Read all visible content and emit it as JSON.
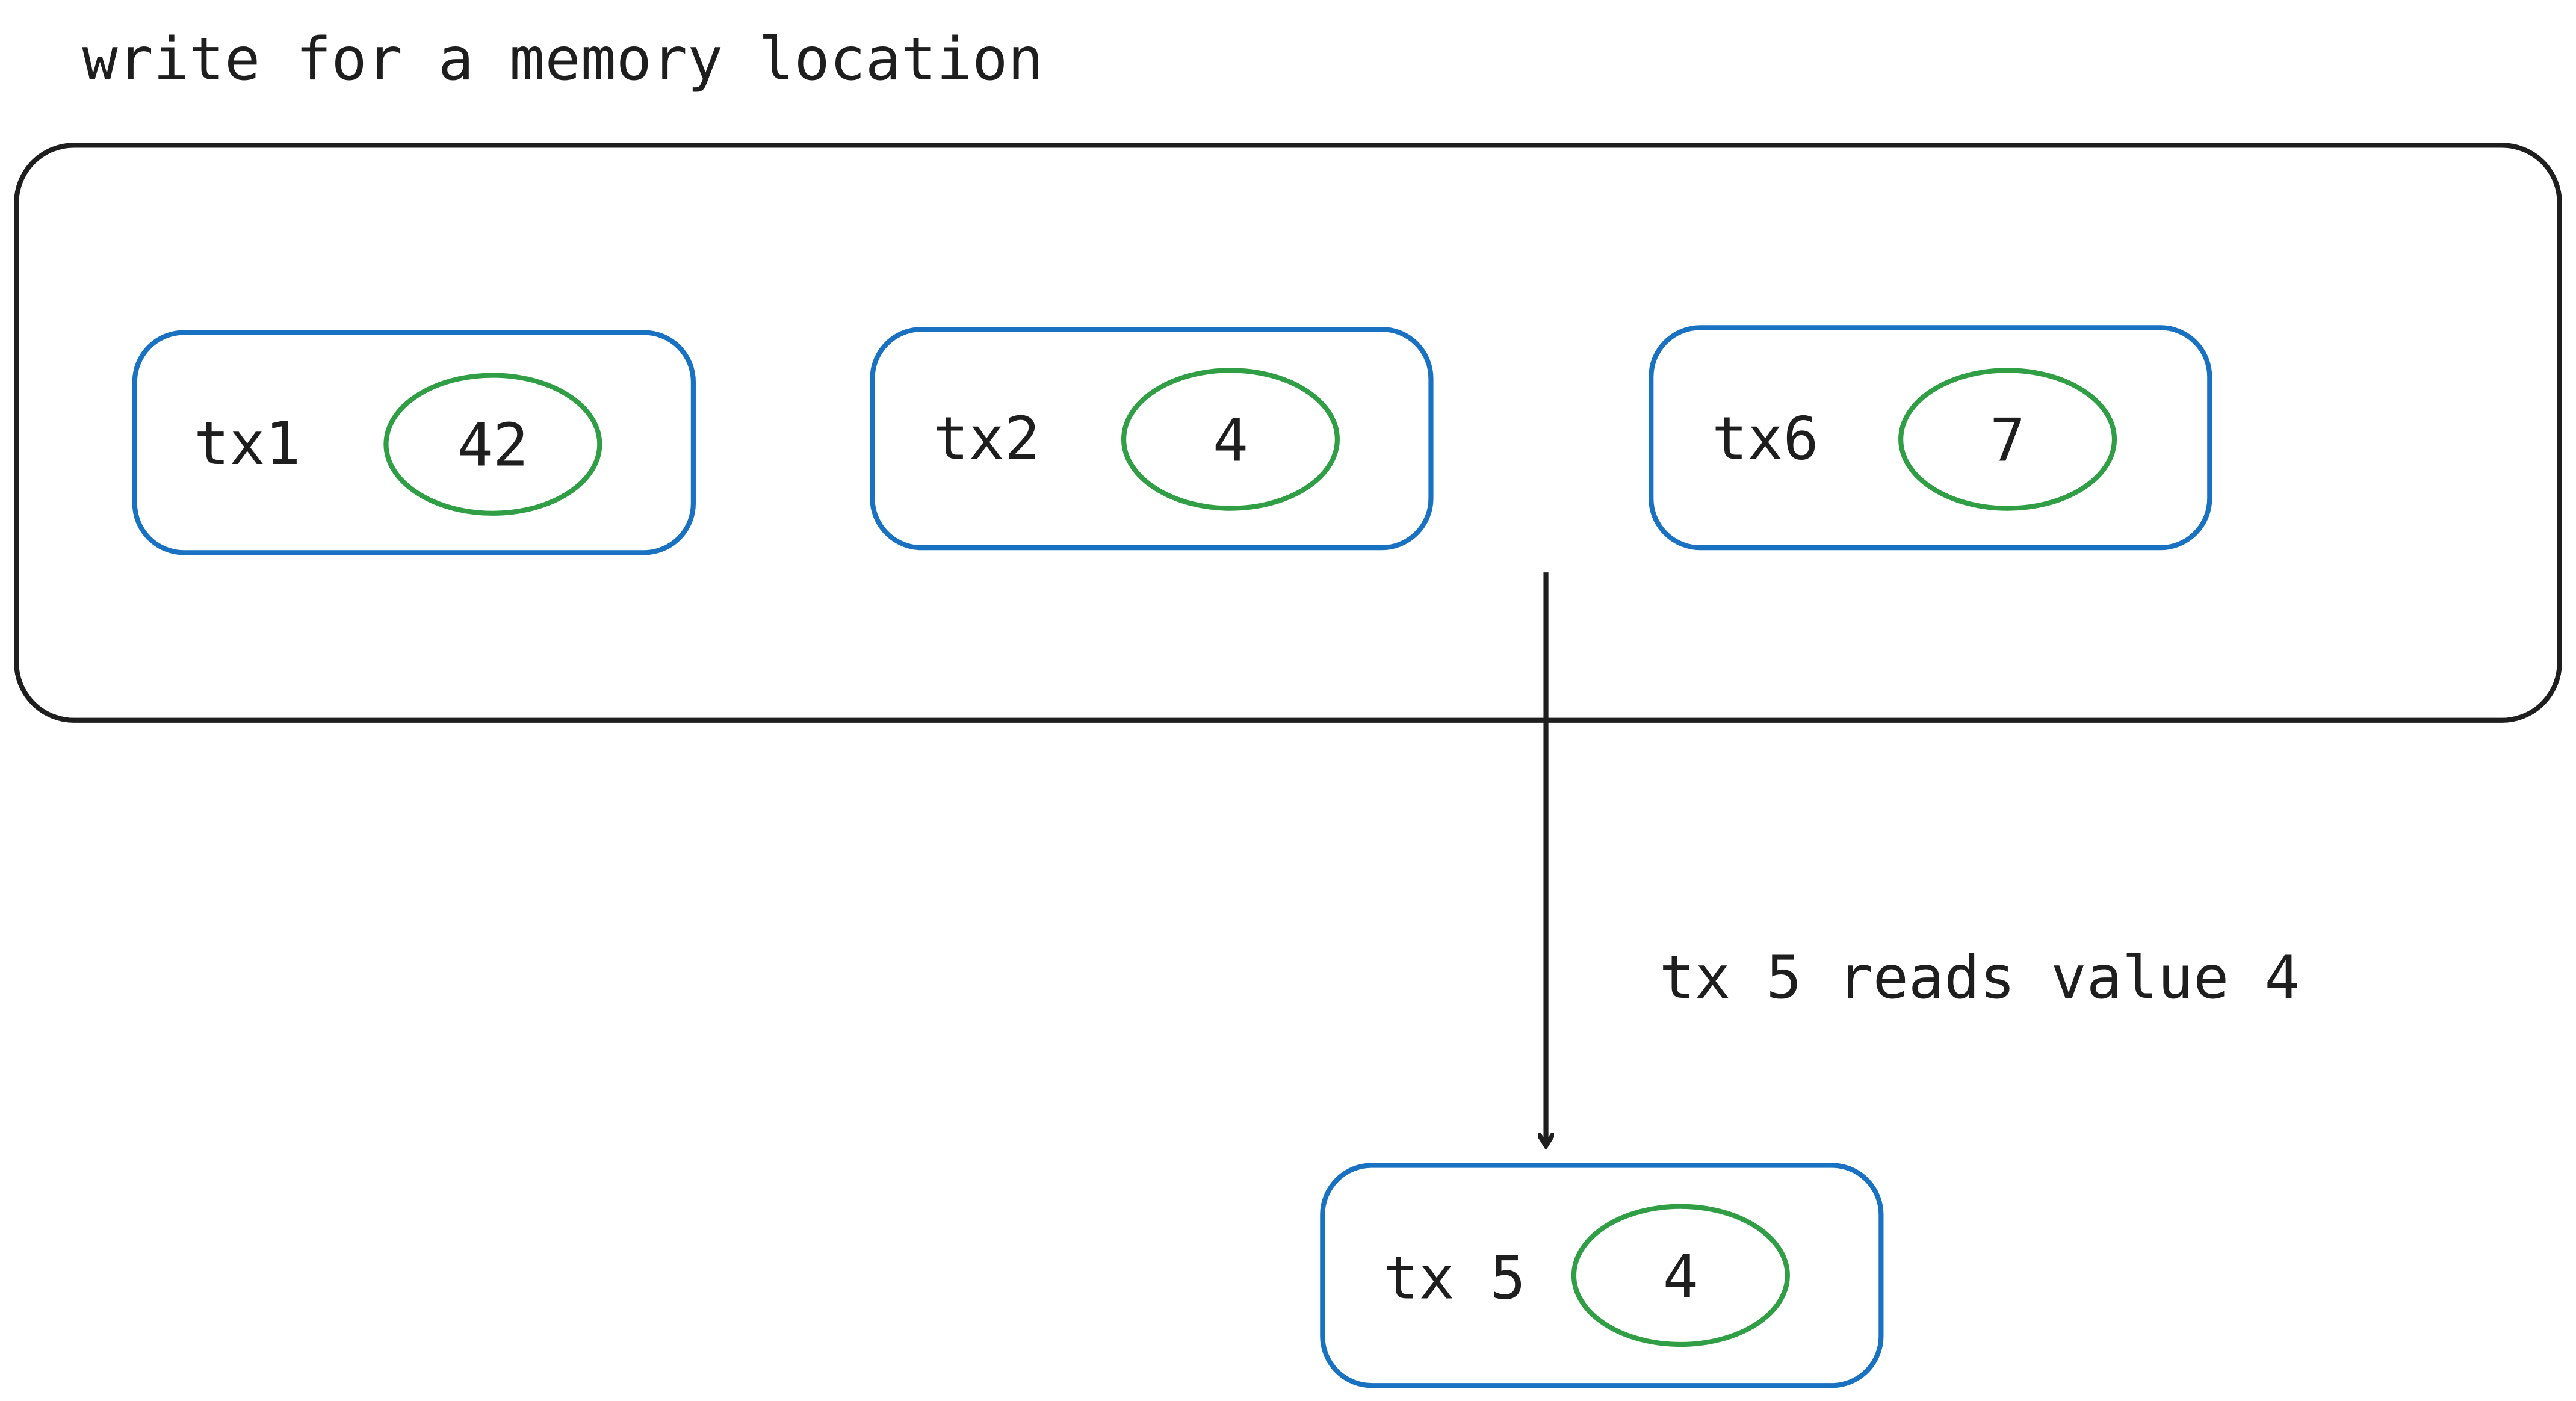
{
  "title": "write for a memory location",
  "colors": {
    "container": "#1e1e1e",
    "tx_box": "#1971c2",
    "value": "#2f9e44",
    "arrow": "#1e1e1e"
  },
  "writes": [
    {
      "tx": "tx1",
      "value": "42"
    },
    {
      "tx": "tx2",
      "value": "4"
    },
    {
      "tx": "tx6",
      "value": "7"
    }
  ],
  "read": {
    "tx": "tx 5",
    "value": "4",
    "label": "tx 5 reads value 4"
  }
}
